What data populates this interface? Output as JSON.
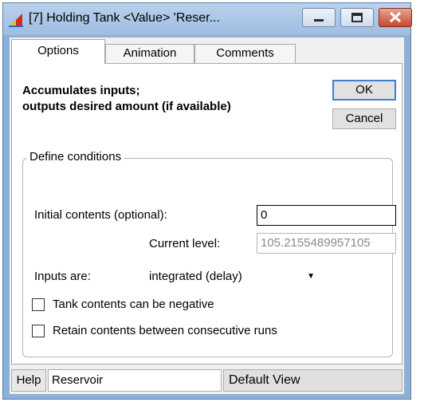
{
  "window": {
    "title": "[7] Holding Tank <Value>  'Reser..."
  },
  "tabs": [
    {
      "label": "Options"
    },
    {
      "label": "Animation"
    },
    {
      "label": "Comments"
    }
  ],
  "options": {
    "description_line1": "Accumulates inputs;",
    "description_line2": "outputs desired amount (if available)",
    "ok_label": "OK",
    "cancel_label": "Cancel",
    "group_label": "Define conditions",
    "initial_contents_label": "Initial contents (optional):",
    "initial_contents_value": "0",
    "current_level_label": "Current level:",
    "current_level_value": "105.2155489957105",
    "inputs_are_label": "Inputs are:",
    "inputs_are_value": "integrated (delay)",
    "checkbox_negative_label": "Tank contents can be negative",
    "checkbox_negative_checked": false,
    "checkbox_retain_label": "Retain contents between consecutive runs",
    "checkbox_retain_checked": false
  },
  "statusbar": {
    "help_label": "Help",
    "block_name": "Reservoir",
    "view_label": "Default View"
  },
  "colors": {
    "title_bar": "#b9d1ec",
    "close_button": "#c44a2f",
    "ok_border": "#3c7fd4"
  },
  "icons": {
    "app": "extend-block-icon",
    "minimize": "minimize-icon",
    "maximize": "maximize-icon",
    "close": "close-icon",
    "dropdown": "chevron-down-icon"
  }
}
